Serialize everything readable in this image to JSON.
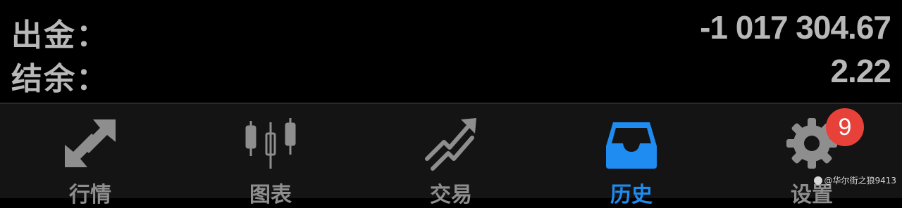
{
  "summary": {
    "withdrawal": {
      "label": "出金：",
      "value": "-1 017 304.67"
    },
    "balance": {
      "label": "结余：",
      "value": "2.22"
    }
  },
  "tabs": [
    {
      "label": "行情",
      "icon": "quotes-arrows-icon"
    },
    {
      "label": "图表",
      "icon": "candlestick-chart-icon"
    },
    {
      "label": "交易",
      "icon": "trade-trend-icon"
    },
    {
      "label": "历史",
      "icon": "inbox-tray-icon",
      "active": true
    },
    {
      "label": "设置",
      "icon": "gear-icon",
      "badge": "9"
    }
  ],
  "colors": {
    "active": "#1e8cf0",
    "inactive": "#8e8e8e",
    "badge": "#e8413a"
  },
  "watermark": "@华尔街之狼9413"
}
